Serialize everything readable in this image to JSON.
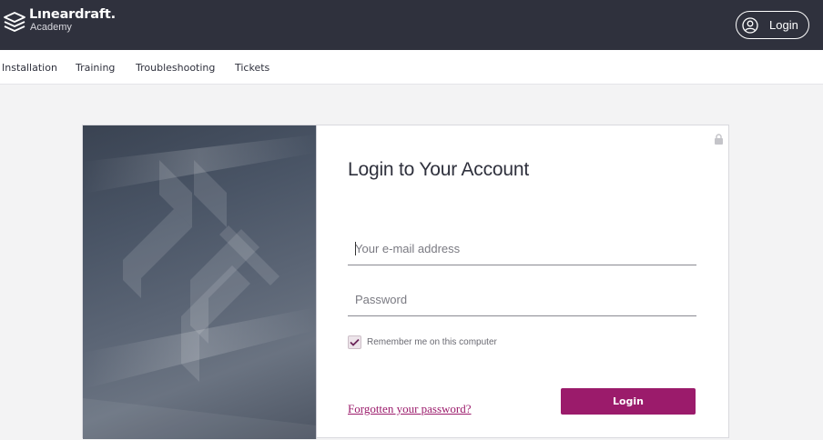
{
  "header": {
    "logo_title": "Lıneardraft.",
    "logo_subtitle": "Academy",
    "logo_icon": "stacked-books-icon",
    "login_label": "Login",
    "login_icon": "user-circle-icon"
  },
  "nav": {
    "items": [
      {
        "label": "Installation"
      },
      {
        "label": "Training"
      },
      {
        "label": "Troubleshooting"
      },
      {
        "label": "Tickets"
      }
    ]
  },
  "login_form": {
    "title": "Login to Your Account",
    "email_placeholder": "Your e-mail address",
    "password_placeholder": "Password",
    "remember_label": "Remember me on this computer",
    "remember_checked": true,
    "forgot_label": "Forgotten your password?",
    "submit_label": "Login",
    "lock_icon": "lock-icon"
  },
  "colors": {
    "header_bg": "#2f313d",
    "accent": "#9b1b6b",
    "page_bg": "#f3f3f4"
  }
}
